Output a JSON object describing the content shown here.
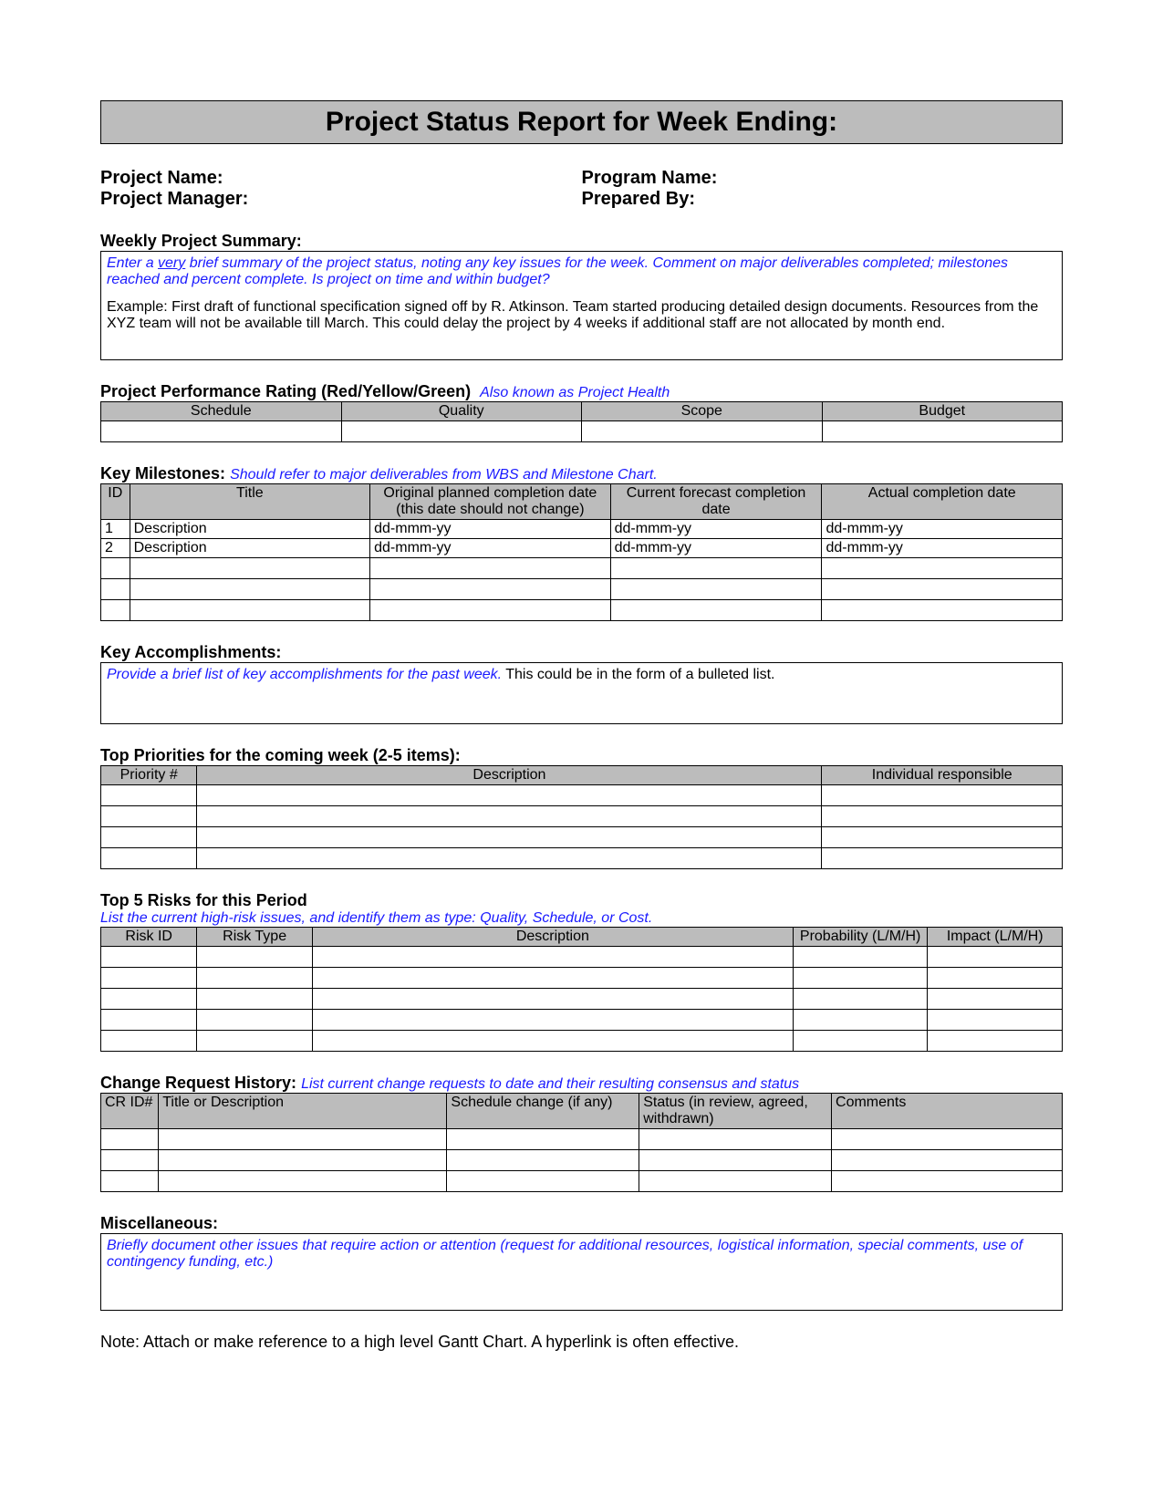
{
  "title": "Project Status Report for Week Ending:",
  "info": {
    "projectNameLabel": "Project Name:",
    "projectManagerLabel": "Project Manager:",
    "programNameLabel": "Program Name:",
    "preparedByLabel": "Prepared By:"
  },
  "summary": {
    "heading": "Weekly Project Summary:",
    "instrPart1": "Enter a ",
    "instrUnder": "very",
    "instrPart2": " brief summary of the project status, noting any key issues for the week. Comment on major deliverables completed; milestones reached and percent complete. Is project on time and within budget?",
    "example": "Example: First draft of functional specification signed off by R. Atkinson. Team started producing detailed design documents. Resources from the XYZ team will not be available till March. This could delay the project by 4 weeks if additional staff are not allocated by month end."
  },
  "performance": {
    "heading": "Project Performance Rating (Red/Yellow/Green)",
    "hint": "Also known as Project Health",
    "cols": [
      "Schedule",
      "Quality",
      "Scope",
      "Budget"
    ]
  },
  "milestones": {
    "heading": "Key Milestones:",
    "hint": "Should refer to major deliverables from WBS and Milestone Chart.",
    "cols": [
      "ID",
      "Title",
      "Original planned completion date (this date should not change)",
      "Current forecast completion date",
      "Actual completion date"
    ],
    "rows": [
      [
        "1",
        "Description",
        "dd-mmm-yy",
        "dd-mmm-yy",
        "dd-mmm-yy"
      ],
      [
        "2",
        "Description",
        "dd-mmm-yy",
        "dd-mmm-yy",
        "dd-mmm-yy"
      ]
    ]
  },
  "accomp": {
    "heading": "Key Accomplishments:",
    "instr": "Provide a brief list of key accomplishments for the past week.",
    "instr2": " This could be in the form of a bulleted list."
  },
  "priorities": {
    "heading": "Top Priorities for the coming week (2-5 items):",
    "cols": [
      "Priority #",
      "Description",
      "Individual responsible"
    ]
  },
  "risks": {
    "heading": "Top 5 Risks for this Period",
    "hint": "List the current high-risk issues, and identify them as type: Quality, Schedule, or Cost.",
    "cols": [
      "Risk ID",
      "Risk Type",
      "Description",
      "Probability (L/M/H)",
      "Impact (L/M/H)"
    ]
  },
  "changes": {
    "heading": "Change Request History:",
    "hint": "List current change requests to date and their resulting consensus and status",
    "cols": [
      "CR ID#",
      "Title or Description",
      "Schedule change (if any)",
      "Status (in review, agreed, withdrawn)",
      "Comments"
    ]
  },
  "misc": {
    "heading": "Miscellaneous:",
    "instr": "Briefly document other issues that require action or attention (request for additional resources, logistical information, special comments, use of contingency funding, etc.)"
  },
  "note": "Note: Attach or make reference to a high level Gantt Chart. A hyperlink is often effective."
}
